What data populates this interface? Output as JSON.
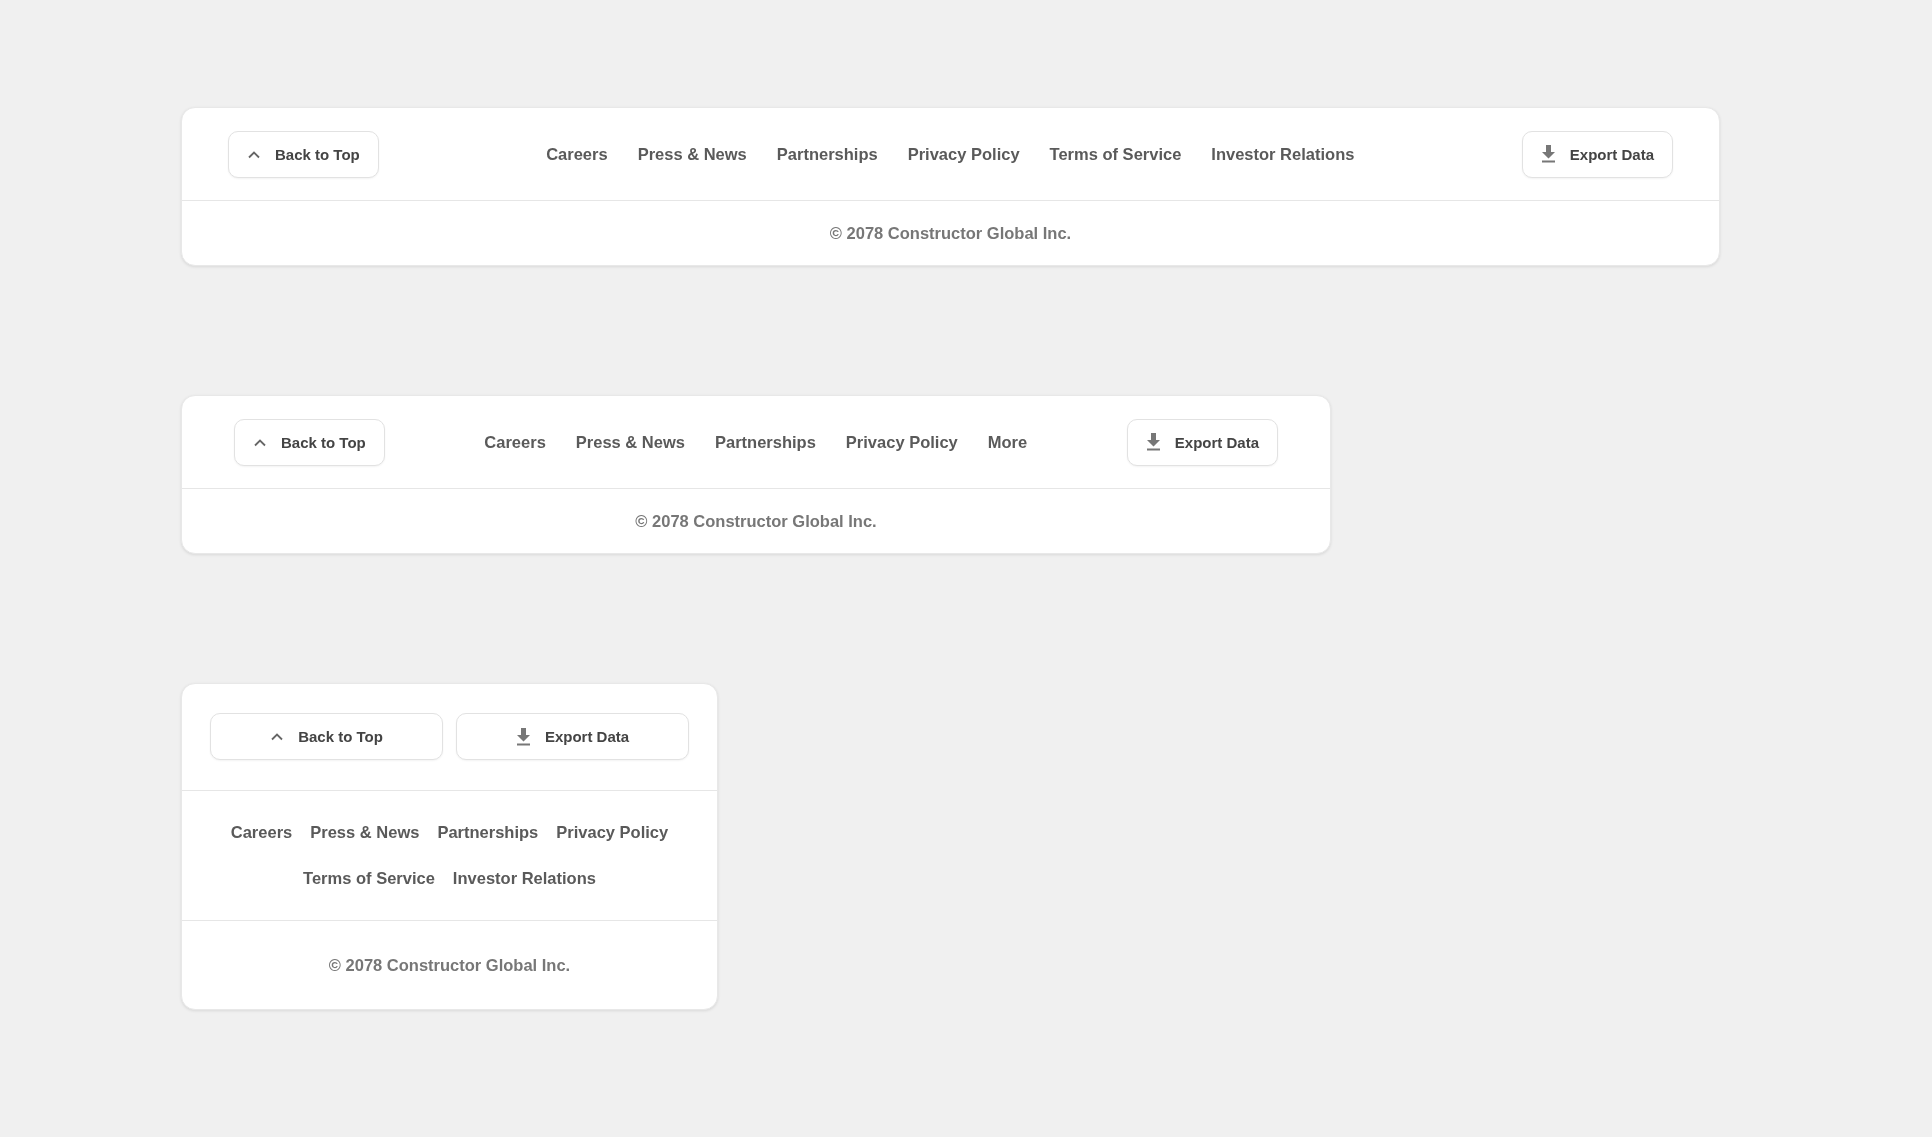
{
  "footers": [
    {
      "kind": "wide",
      "back_button": "Back to Top",
      "links": [
        "Careers",
        "Press & News",
        "Partnerships",
        "Privacy Policy",
        "Terms of Service",
        "Investor Relations"
      ],
      "export_button": "Export Data",
      "copyright": "© 2078 Constructor Global Inc."
    },
    {
      "kind": "medium",
      "back_button": "Back to Top",
      "links": [
        "Careers",
        "Press & News",
        "Partnerships",
        "Privacy Policy",
        "More"
      ],
      "export_button": "Export Data",
      "copyright": "© 2078 Constructor Global Inc."
    },
    {
      "kind": "stacked",
      "back_button": "Back to Top",
      "links": [
        "Careers",
        "Press & News",
        "Partnerships",
        "Privacy Policy",
        "Terms of Service",
        "Investor Relations"
      ],
      "export_button": "Export Data",
      "copyright": "© 2078 Constructor Global Inc."
    }
  ]
}
